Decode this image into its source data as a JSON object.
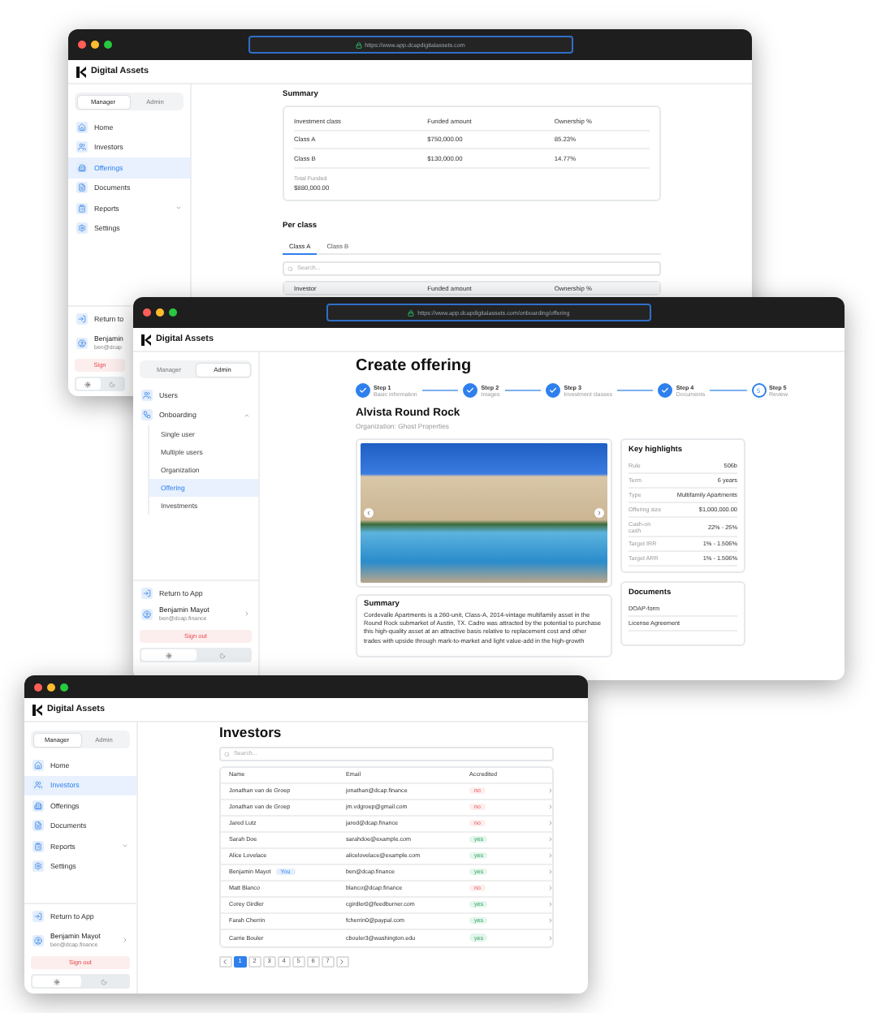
{
  "summary_window": {
    "url": "https://www.app.dcapdigitalassets.com",
    "brand": "Digital Assets",
    "sidebar": {
      "role_tabs": [
        {
          "label": "Manager",
          "selected": true
        },
        {
          "label": "Admin",
          "selected": false
        }
      ],
      "nav": [
        {
          "label": "Home",
          "selected": false
        },
        {
          "label": "Investors",
          "selected": false
        },
        {
          "label": "Offerings",
          "selected": true
        },
        {
          "label": "Documents",
          "selected": false
        },
        {
          "label": "Reports",
          "selected": false,
          "expanded": false
        },
        {
          "label": "Settings",
          "selected": false
        }
      ],
      "footer": {
        "return_label": "Return to",
        "user_name": "Benjamin",
        "user_email": "ben@dcap",
        "sign_out": "Sign",
        "theme": [
          {
            "kind": "light",
            "selected": true
          },
          {
            "kind": "dark",
            "selected": false
          }
        ]
      }
    },
    "summary_title": "Summary",
    "summary_table": {
      "columns": [
        "Investment class",
        "Funded amount",
        "Ownership %"
      ],
      "rows": [
        [
          "Class A",
          "$750,000.00",
          "85.23%"
        ],
        [
          "Class B",
          "$130,000.00",
          "14.77%"
        ]
      ]
    },
    "total_label": "Total Funded",
    "total_value": "$880,000.00",
    "per_class_title": "Per class",
    "class_tabs": [
      {
        "label": "Class A",
        "selected": true
      },
      {
        "label": "Class B",
        "selected": false
      }
    ],
    "search_placeholder": "Search...",
    "per_class_columns": [
      "Investor",
      "Funded amount",
      "Ownership %"
    ]
  },
  "offering_window": {
    "url": "https://www.app.dcapdigitalassets.com/onboarding/offering",
    "brand": "Digital Assets",
    "sidebar": {
      "role_tabs": [
        {
          "label": "Manager",
          "selected": false
        },
        {
          "label": "Admin",
          "selected": true
        }
      ],
      "nav": [
        {
          "label": "Users",
          "selected": false
        },
        {
          "label": "Onboarding",
          "selected": false,
          "expanded": true,
          "children": [
            {
              "label": "Single user",
              "selected": false
            },
            {
              "label": "Multiple users",
              "selected": false
            },
            {
              "label": "Organization",
              "selected": false
            },
            {
              "label": "Offering",
              "selected": true
            },
            {
              "label": "Investments",
              "selected": false
            }
          ]
        }
      ],
      "footer": {
        "return_label": "Return to App",
        "user_name": "Benjamin Mayot",
        "user_email": "ben@dcap.finance",
        "sign_out": "Sign out",
        "theme": [
          {
            "kind": "light",
            "selected": true
          },
          {
            "kind": "dark",
            "selected": false
          }
        ]
      }
    },
    "title": "Create offering",
    "steps": [
      {
        "title": "Step 1",
        "subtitle": "Basic information",
        "done": true
      },
      {
        "title": "Step 2",
        "subtitle": "Images",
        "done": true
      },
      {
        "title": "Step 3",
        "subtitle": "Investment classes",
        "done": true
      },
      {
        "title": "Step 4",
        "subtitle": "Documents",
        "done": true
      },
      {
        "title": "Step 5",
        "subtitle": "Review",
        "number": "5",
        "done": false
      }
    ],
    "offering_name": "Alvista Round Rock",
    "organization": "Organization: Ghost Properties",
    "summary_title": "Summary",
    "summary_text": "Cordevalle Apartments is a 260-unit, Class-A, 2014-vintage multifamily asset in the Round Rock submarket of Austin, TX. Cadre was attracted by the potential to purchase this high-quality asset at an attractive basis relative to replacement cost and other trades with upside through mark-to-market and light value-add in the high-growth",
    "highlights_title": "Key highlights",
    "highlights": [
      {
        "label": "Rule",
        "value": "506b"
      },
      {
        "label": "Term",
        "value": "6 years"
      },
      {
        "label": "Type",
        "value": "Multifamily Apartments"
      },
      {
        "label": "Offering size",
        "value": "$1,000,000.00"
      },
      {
        "label": "Cash-on cash",
        "value": "22% - 25%"
      },
      {
        "label": "Target IRR",
        "value": "1% - 1.506%"
      },
      {
        "label": "Target ARR",
        "value": "1% - 1.506%"
      }
    ],
    "documents_title": "Documents",
    "documents": [
      "DOAP-form",
      "License Agreement"
    ]
  },
  "investors_window": {
    "brand": "Digital Assets",
    "sidebar": {
      "role_tabs": [
        {
          "label": "Manager",
          "selected": true
        },
        {
          "label": "Admin",
          "selected": false
        }
      ],
      "nav": [
        {
          "label": "Home",
          "selected": false
        },
        {
          "label": "Investors",
          "selected": true
        },
        {
          "label": "Offerings",
          "selected": false
        },
        {
          "label": "Documents",
          "selected": false
        },
        {
          "label": "Reports",
          "selected": false,
          "expanded": false
        },
        {
          "label": "Settings",
          "selected": false
        }
      ],
      "footer": {
        "return_label": "Return to App",
        "user_name": "Benjamin Mayot",
        "user_email": "ben@dcap.finance",
        "sign_out": "Sign out",
        "theme": [
          {
            "kind": "light",
            "selected": true
          },
          {
            "kind": "dark",
            "selected": false
          }
        ]
      }
    },
    "title": "Investors",
    "search_placeholder": "Search...",
    "columns": [
      "Name",
      "Email",
      "Accredited"
    ],
    "rows": [
      {
        "name": "Jonathan van de Groep",
        "email": "jonathan@dcap.finance",
        "accredited": false,
        "accredited_label": "no"
      },
      {
        "name": "Jonathan van de Groep",
        "email": "jm.vdgroep@gmail.com",
        "accredited": false,
        "accredited_label": "no"
      },
      {
        "name": "Jared Lutz",
        "email": "jared@dcap.finance",
        "accredited": false,
        "accredited_label": "no"
      },
      {
        "name": "Sarah Doe",
        "email": "sarahdoe@example.com",
        "accredited": true,
        "accredited_label": "yes"
      },
      {
        "name": "Alice Lovelace",
        "email": "alicelovelace@example.com",
        "accredited": true,
        "accredited_label": "yes"
      },
      {
        "name": "Benjamin Mayot",
        "badge": "You",
        "email": "ben@dcap.finance",
        "accredited": true,
        "accredited_label": "yes"
      },
      {
        "name": "Matt Blanco",
        "email": "blanco@dcap.finance",
        "accredited": false,
        "accredited_label": "no"
      },
      {
        "name": "Corey Girdler",
        "email": "cgirdler0@feedburner.com",
        "accredited": true,
        "accredited_label": "yes"
      },
      {
        "name": "Farah Cherrin",
        "email": "fcherrin0@paypal.com",
        "accredited": true,
        "accredited_label": "yes"
      },
      {
        "name": "Carrie Bouler",
        "email": "cbouler3@washington.edu",
        "accredited": true,
        "accredited_label": "yes"
      }
    ],
    "pages": [
      {
        "label": "1",
        "selected": true
      },
      {
        "label": "2",
        "selected": false
      },
      {
        "label": "3",
        "selected": false
      },
      {
        "label": "4",
        "selected": false
      },
      {
        "label": "5",
        "selected": false
      },
      {
        "label": "6",
        "selected": false
      },
      {
        "label": "7",
        "selected": false
      }
    ]
  }
}
